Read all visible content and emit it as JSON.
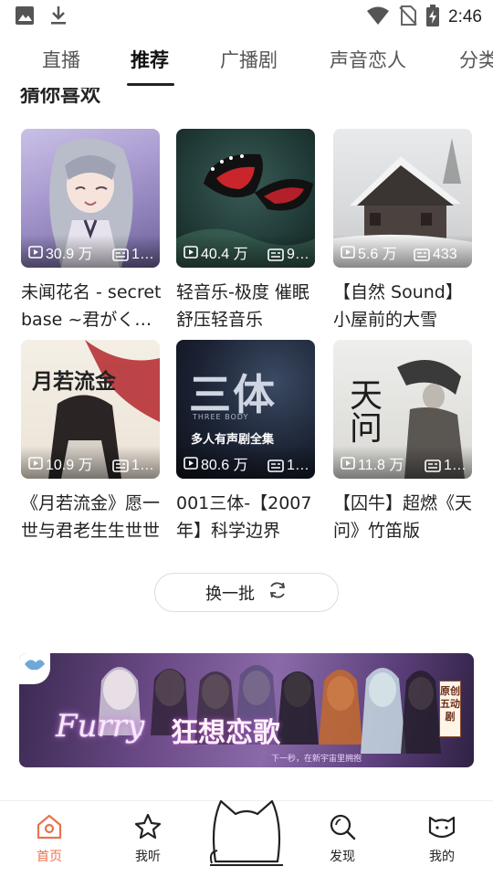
{
  "status_bar": {
    "time": "2:46",
    "icons": [
      "image-icon",
      "download-icon",
      "wifi-icon",
      "no-sim-icon",
      "battery-charging-icon"
    ]
  },
  "tabs": [
    {
      "label": "直播",
      "active": false
    },
    {
      "label": "推荐",
      "active": true
    },
    {
      "label": "广播剧",
      "active": false
    },
    {
      "label": "声音恋人",
      "active": false
    },
    {
      "label": "分类",
      "active": false
    }
  ],
  "section": {
    "title": "猜你喜欢"
  },
  "cards": [
    {
      "title": "未闻花名 - secret base ~君がくれたもの~",
      "plays": "30.9 万",
      "episodes": "1…"
    },
    {
      "title": "轻音乐-极度 催眠舒压轻音乐",
      "plays": "40.4 万",
      "episodes": "9…"
    },
    {
      "title": "【自然 Sound】小屋前的大雪",
      "plays": "5.6 万",
      "episodes": "433"
    },
    {
      "title": "《月若流金》愿一世与君老生生世世",
      "plays": "10.9 万",
      "episodes": "1…"
    },
    {
      "title": "001三体-【2007年】科学边界",
      "plays": "80.6 万",
      "episodes": "1…"
    },
    {
      "title": "【囚牛】超燃《天问》竹笛版",
      "plays": "11.8 万",
      "episodes": "1…"
    }
  ],
  "thumb_text": {
    "card4": "月若流金",
    "card5_big": "三体",
    "card5_sub": "THREE BODY",
    "card5_caption": "多人有声剧全集",
    "card6": "天问"
  },
  "refresh_button": {
    "label": "换一批"
  },
  "banner": {
    "title_latin": "Furry",
    "title_cn": "狂想恋歌",
    "subtitle": "下一秒，在新宇宙里拥抱",
    "badge": "原创五动剧"
  },
  "bottom_nav": [
    {
      "label": "首页",
      "icon": "home-icon",
      "active": true
    },
    {
      "label": "我听",
      "icon": "star-icon",
      "active": false
    },
    {
      "label": "",
      "icon": "cat-mascot-icon",
      "active": false
    },
    {
      "label": "发现",
      "icon": "discover-search-icon",
      "active": false
    },
    {
      "label": "我的",
      "icon": "cat-face-icon",
      "active": false
    }
  ],
  "colors": {
    "accent": "#e8734f",
    "text": "#222222",
    "tab_inactive": "#555555"
  }
}
